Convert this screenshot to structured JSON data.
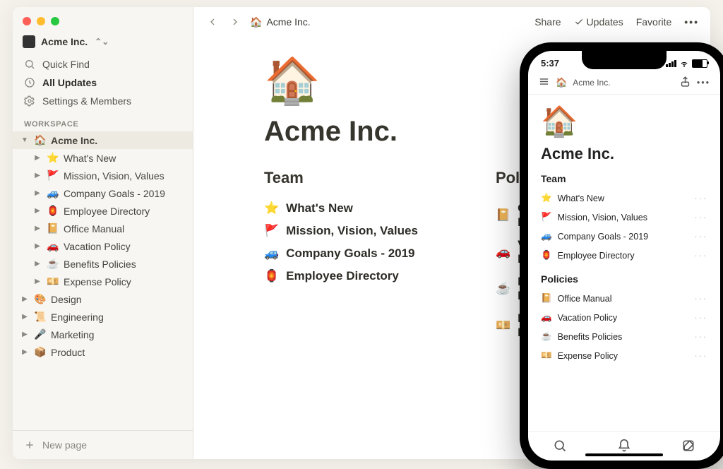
{
  "workspace": {
    "name": "Acme Inc."
  },
  "sidebar": {
    "quick_find": "Quick Find",
    "all_updates": "All Updates",
    "settings": "Settings & Members",
    "section_label": "WORKSPACE",
    "new_page": "New page",
    "tree": [
      {
        "emoji": "🏠",
        "label": "Acme Inc.",
        "depth": 1,
        "open": true,
        "selected": true
      },
      {
        "emoji": "⭐",
        "label": "What's New",
        "depth": 2
      },
      {
        "emoji": "🚩",
        "label": "Mission, Vision, Values",
        "depth": 2
      },
      {
        "emoji": "🚙",
        "label": "Company Goals - 2019",
        "depth": 2
      },
      {
        "emoji": "🏮",
        "label": "Employee Directory",
        "depth": 2
      },
      {
        "emoji": "📔",
        "label": "Office Manual",
        "depth": 2
      },
      {
        "emoji": "🚗",
        "label": "Vacation Policy",
        "depth": 2
      },
      {
        "emoji": "☕",
        "label": "Benefits Policies",
        "depth": 2
      },
      {
        "emoji": "💴",
        "label": "Expense Policy",
        "depth": 2
      },
      {
        "emoji": "🎨",
        "label": "Design",
        "depth": 1
      },
      {
        "emoji": "📜",
        "label": "Engineering",
        "depth": 1
      },
      {
        "emoji": "🎤",
        "label": "Marketing",
        "depth": 1
      },
      {
        "emoji": "📦",
        "label": "Product",
        "depth": 1
      }
    ]
  },
  "topbar": {
    "breadcrumb_emoji": "🏠",
    "breadcrumb": "Acme Inc.",
    "share": "Share",
    "updates": "Updates",
    "favorite": "Favorite"
  },
  "page": {
    "hero_emoji": "🏠",
    "title": "Acme Inc.",
    "columns": [
      {
        "heading": "Team",
        "links": [
          {
            "emoji": "⭐",
            "label": "What's New"
          },
          {
            "emoji": "🚩",
            "label": "Mission, Vision, Values"
          },
          {
            "emoji": "🚙",
            "label": "Company Goals - 2019"
          },
          {
            "emoji": "🏮",
            "label": "Employee Directory"
          }
        ]
      },
      {
        "heading": "Policies",
        "links": [
          {
            "emoji": "📔",
            "label": "Office Manual"
          },
          {
            "emoji": "🚗",
            "label": "Vacation Policy"
          },
          {
            "emoji": "☕",
            "label": "Benefits Policies"
          },
          {
            "emoji": "💴",
            "label": "Expense Policy"
          }
        ]
      }
    ]
  },
  "mobile": {
    "time": "5:37",
    "breadcrumb_emoji": "🏠",
    "breadcrumb": "Acme Inc.",
    "hero_emoji": "🏠",
    "title": "Acme Inc.",
    "sections": [
      {
        "heading": "Team",
        "links": [
          {
            "emoji": "⭐",
            "label": "What's New"
          },
          {
            "emoji": "🚩",
            "label": "Mission, Vision, Values"
          },
          {
            "emoji": "🚙",
            "label": "Company Goals - 2019"
          },
          {
            "emoji": "🏮",
            "label": "Employee Directory"
          }
        ]
      },
      {
        "heading": "Policies",
        "links": [
          {
            "emoji": "📔",
            "label": "Office Manual"
          },
          {
            "emoji": "🚗",
            "label": "Vacation Policy"
          },
          {
            "emoji": "☕",
            "label": "Benefits Policies"
          },
          {
            "emoji": "💴",
            "label": "Expense Policy"
          }
        ]
      }
    ]
  }
}
